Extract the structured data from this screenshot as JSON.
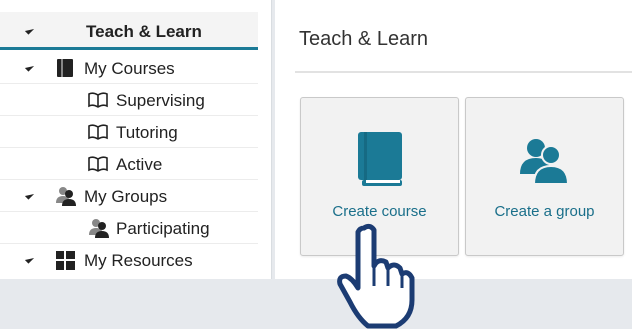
{
  "sidebar": {
    "root": {
      "label": "Teach & Learn"
    },
    "items": [
      {
        "label": "My Courses",
        "icon": "book-icon"
      },
      {
        "label": "Supervising",
        "icon": "open-book-icon"
      },
      {
        "label": "Tutoring",
        "icon": "open-book-icon"
      },
      {
        "label": "Active",
        "icon": "open-book-icon"
      },
      {
        "label": "My Groups",
        "icon": "group-icon"
      },
      {
        "label": "Participating",
        "icon": "group-icon"
      },
      {
        "label": "My Resources",
        "icon": "grid-icon"
      }
    ]
  },
  "main": {
    "title": "Teach & Learn",
    "tiles": [
      {
        "label": "Create course",
        "icon": "book-icon"
      },
      {
        "label": "Create a group",
        "icon": "group-icon"
      }
    ]
  },
  "colors": {
    "accent": "#1b7a96",
    "tile_label": "#1a6f8a",
    "background": "#e6e9ed"
  }
}
